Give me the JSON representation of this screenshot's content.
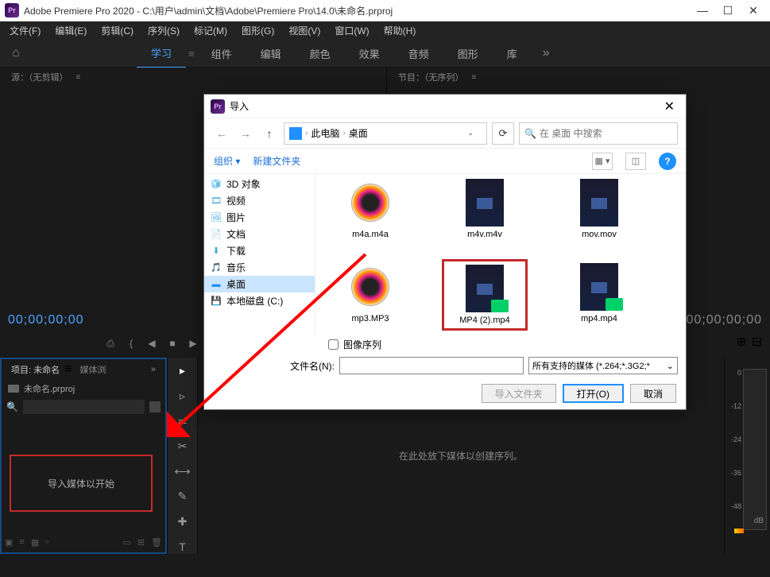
{
  "titlebar": {
    "logo": "Pr",
    "text": "Adobe Premiere Pro 2020 - C:\\用户\\admin\\文档\\Adobe\\Premiere Pro\\14.0\\未命名.prproj"
  },
  "menu": {
    "items": [
      "文件(F)",
      "编辑(E)",
      "剪辑(C)",
      "序列(S)",
      "标记(M)",
      "图形(G)",
      "视图(V)",
      "窗口(W)",
      "帮助(H)"
    ]
  },
  "workspace": {
    "tabs": [
      "学习",
      "组件",
      "编辑",
      "颜色",
      "效果",
      "音频",
      "图形",
      "库"
    ],
    "active_index": 0,
    "more": "»"
  },
  "panels": {
    "source": {
      "label": "源：（无剪辑）",
      "menu_caret": "≡",
      "timecode_start": "00;00;00;00"
    },
    "program": {
      "label": "节目：（无序列）",
      "menu_caret": "≡",
      "timecode_end": "00;00;00;00"
    },
    "transport_icons": [
      "⎙",
      "{",
      "◀",
      "■",
      "▶",
      "}",
      "⤹",
      "+",
      "⎚"
    ]
  },
  "project": {
    "tab_main": "项目: 未命名",
    "tab_sec": "媒体浏",
    "menu_caret": "≡",
    "more": "»",
    "filename": "未命名.prproj",
    "import_hint": "导入媒体以开始",
    "bottom_icons": [
      "▣",
      "≡",
      "▦",
      "▫",
      "◐",
      "▭",
      "⊞",
      "🗑"
    ]
  },
  "tools": {
    "icons": [
      "▸",
      "▹",
      "⇄",
      "✂",
      "⟷",
      "✎",
      "✚",
      "T"
    ]
  },
  "timeline": {
    "hint": "在此处放下媒体以创建序列。"
  },
  "audio_meter": {
    "ticks": [
      "0",
      "-12",
      "-24",
      "-36",
      "-48"
    ],
    "unit": "dB"
  },
  "dialog": {
    "logo": "Pr",
    "title": "导入",
    "breadcrumbs": {
      "root": "此电脑",
      "folder": "桌面"
    },
    "search_placeholder": "在 桌面 中搜索",
    "toolbar": {
      "organize": "组织 ▾",
      "new_folder": "新建文件夹"
    },
    "tree_items": [
      {
        "icon": "🧊",
        "label": "3D 对象",
        "color": "#3aa7d8"
      },
      {
        "icon": "🎞",
        "label": "视频",
        "color": "#3aa7d8"
      },
      {
        "icon": "🖼",
        "label": "图片",
        "color": "#3aa7d8"
      },
      {
        "icon": "📄",
        "label": "文档",
        "color": "#3aa7d8"
      },
      {
        "icon": "⬇",
        "label": "下载",
        "color": "#3aa7d8"
      },
      {
        "icon": "🎵",
        "label": "音乐",
        "color": "#3aa7d8"
      },
      {
        "icon": "▬",
        "label": "桌面",
        "color": "#1e90ff",
        "selected": true
      },
      {
        "icon": "💾",
        "label": "本地磁盘 (C:)",
        "color": "#888"
      }
    ],
    "files": [
      {
        "name": "m4a.m4a",
        "type": "audio"
      },
      {
        "name": "m4v.m4v",
        "type": "video"
      },
      {
        "name": "mov.mov",
        "type": "video"
      },
      {
        "name": "mp3.MP3",
        "type": "audio"
      },
      {
        "name": "MP4 (2).mp4",
        "type": "video",
        "badge": true,
        "highlighted": true
      },
      {
        "name": "mp4.mp4",
        "type": "video",
        "badge": true
      }
    ],
    "sequence_checkbox": "图像序列",
    "filename_label": "文件名(N):",
    "filename_value": "",
    "filter": "所有支持的媒体 (*.264;*.3G2;*",
    "buttons": {
      "import_folder": "导入文件夹",
      "open": "打开(O)",
      "cancel": "取消"
    }
  }
}
